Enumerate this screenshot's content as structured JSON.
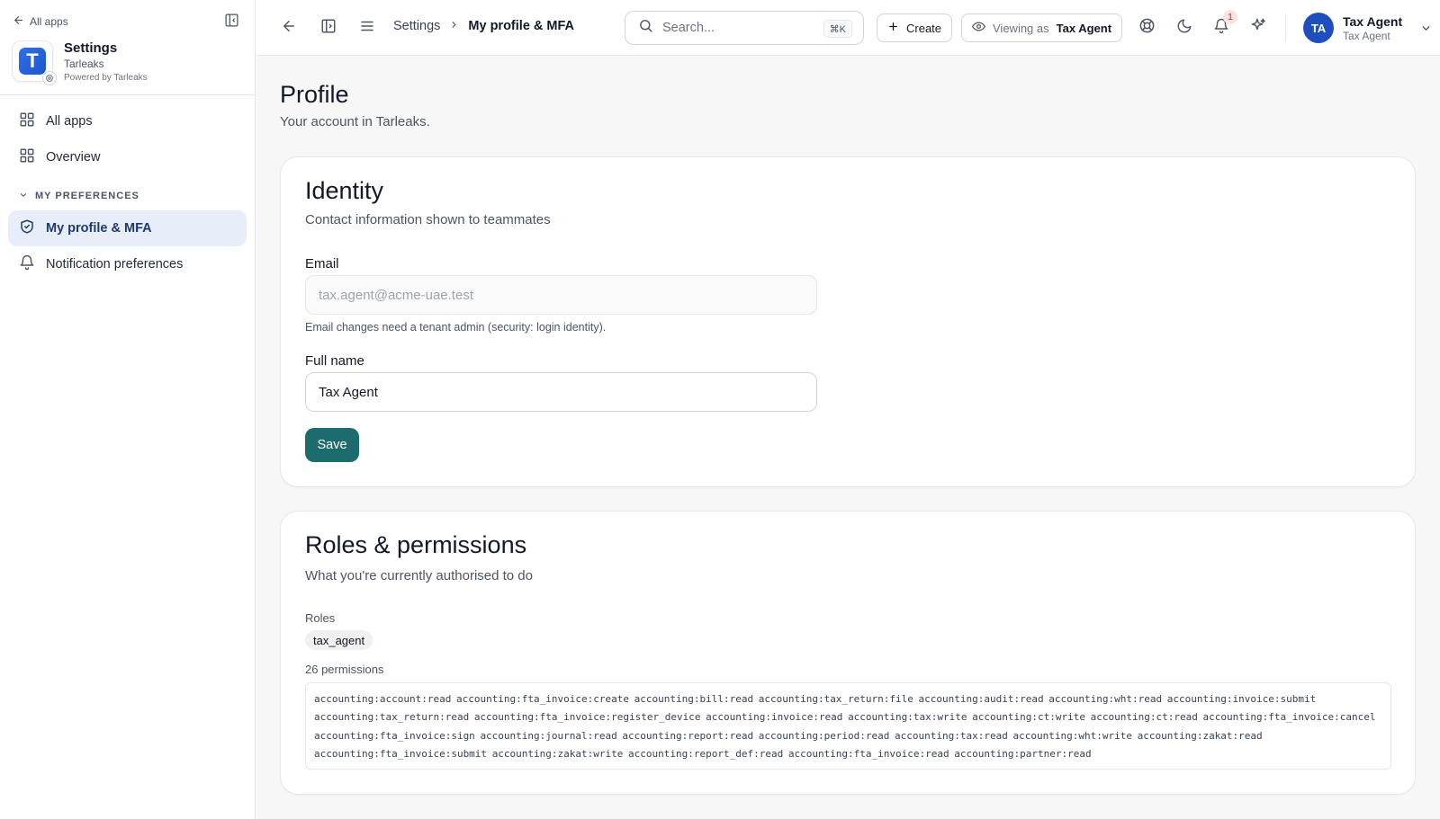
{
  "sidebar": {
    "back_label": "All apps",
    "app_name": "Settings",
    "app_tenant": "Tarleaks",
    "app_powered_by": "Powered by Tarleaks",
    "app_logo_letter": "T",
    "nav": {
      "all_apps": "All apps",
      "overview": "Overview",
      "section_label": "MY PREFERENCES",
      "profile_mfa": "My profile & MFA",
      "notifications": "Notification preferences"
    }
  },
  "header": {
    "breadcrumb_parent": "Settings",
    "breadcrumb_current": "My profile & MFA",
    "search_placeholder": "Search...",
    "search_shortcut": "⌘K",
    "create_label": "Create",
    "viewing_label": "Viewing as",
    "viewing_role": "Tax Agent",
    "notification_count": "1",
    "user_initials": "TA",
    "user_name": "Tax Agent",
    "user_role": "Tax Agent"
  },
  "page": {
    "title": "Profile",
    "subtitle": "Your account in Tarleaks."
  },
  "identity": {
    "title": "Identity",
    "subtitle": "Contact information shown to teammates",
    "email_label": "Email",
    "email_value": "tax.agent@acme-uae.test",
    "email_help": "Email changes need a tenant admin (security: login identity).",
    "fullname_label": "Full name",
    "fullname_value": "Tax Agent",
    "save_label": "Save"
  },
  "roles": {
    "title": "Roles & permissions",
    "subtitle": "What you're currently authorised to do",
    "roles_label": "Roles",
    "role_pill": "tax_agent",
    "permissions_count_label": "26 permissions",
    "permissions": [
      "accounting:account:read",
      "accounting:fta_invoice:create",
      "accounting:bill:read",
      "accounting:tax_return:file",
      "accounting:audit:read",
      "accounting:wht:read",
      "accounting:invoice:submit",
      "accounting:tax_return:read",
      "accounting:fta_invoice:register_device",
      "accounting:invoice:read",
      "accounting:tax:write",
      "accounting:ct:write",
      "accounting:ct:read",
      "accounting:fta_invoice:cancel",
      "accounting:fta_invoice:sign",
      "accounting:journal:read",
      "accounting:report:read",
      "accounting:period:read",
      "accounting:tax:read",
      "accounting:wht:write",
      "accounting:zakat:read",
      "accounting:fta_invoice:submit",
      "accounting:zakat:write",
      "accounting:report_def:read",
      "accounting:fta_invoice:read",
      "accounting:partner:read"
    ]
  }
}
